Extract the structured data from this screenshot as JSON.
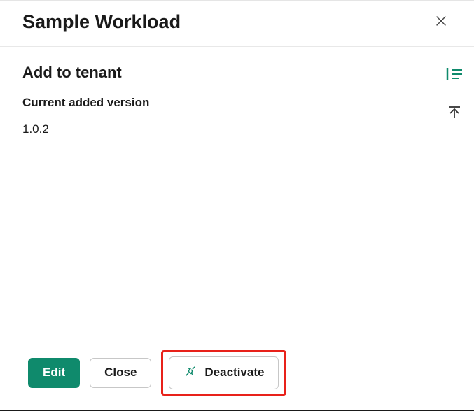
{
  "header": {
    "title": "Sample Workload"
  },
  "panel": {
    "section_title": "Add to tenant",
    "version_label": "Current added version",
    "version_value": "1.0.2"
  },
  "actions": {
    "edit": "Edit",
    "close": "Close",
    "deactivate": "Deactivate"
  },
  "colors": {
    "primary": "#0f8a6c",
    "highlight": "#e8211a"
  }
}
